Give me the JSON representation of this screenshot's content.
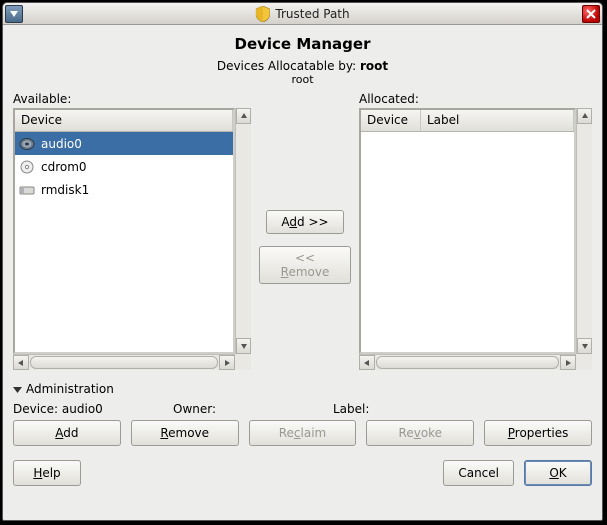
{
  "titlebar": {
    "title": "Trusted Path"
  },
  "header": {
    "title": "Device Manager",
    "alloc_prefix": "Devices Allocatable by: ",
    "alloc_user": "root",
    "alloc_sub": "root"
  },
  "labels": {
    "available": "Available:",
    "allocated": "Allocated:"
  },
  "available": {
    "header": "Device",
    "items": [
      {
        "name": "audio0",
        "icon": "audio",
        "selected": true
      },
      {
        "name": "cdrom0",
        "icon": "cd",
        "selected": false
      },
      {
        "name": "rmdisk1",
        "icon": "disk",
        "selected": false
      }
    ]
  },
  "allocated": {
    "headers": [
      "Device",
      "Label"
    ],
    "items": []
  },
  "transfer": {
    "add_prefix": "A",
    "add_ul": "d",
    "add_suffix": "d >>",
    "remove_prefix": "<< ",
    "remove_ul": "R",
    "remove_suffix": "emove"
  },
  "admin": {
    "section": "Administration",
    "device_label": "Device:",
    "device_value": "audio0",
    "owner_label": "Owner:",
    "owner_value": "",
    "label_label": "Label:",
    "label_value": "",
    "buttons": {
      "add_ul": "A",
      "add_rest": "dd",
      "remove_ul": "R",
      "remove_rest": "emove",
      "reclaim_pre": "Re",
      "reclaim_ul": "c",
      "reclaim_post": "laim",
      "revoke_pre": "Re",
      "revoke_ul": "v",
      "revoke_post": "oke",
      "props_ul": "P",
      "props_rest": "roperties"
    }
  },
  "footer": {
    "help_ul": "H",
    "help_rest": "elp",
    "cancel": "Cancel",
    "ok_ul": "O",
    "ok_rest": "K"
  }
}
